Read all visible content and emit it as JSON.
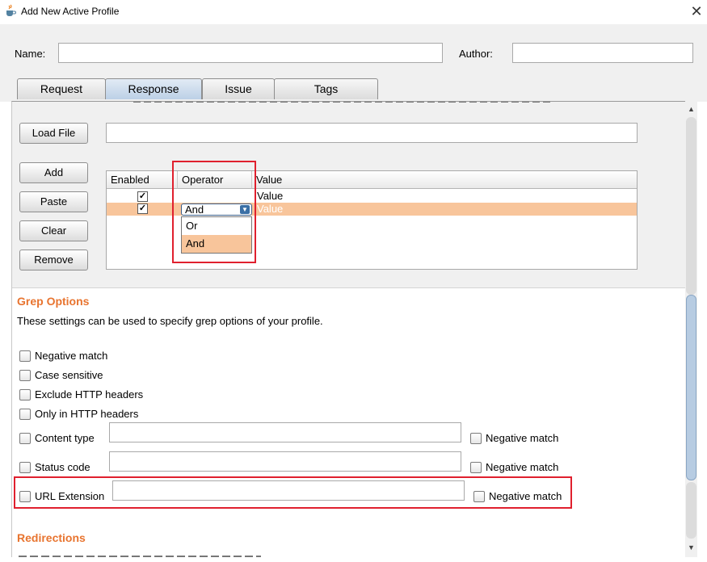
{
  "window": {
    "title": "Add New Active Profile",
    "close_glyph": "✕"
  },
  "header": {
    "name_label": "Name:",
    "name_value": "",
    "author_label": "Author:",
    "author_value": ""
  },
  "tabs": [
    {
      "label": "Request",
      "active": false
    },
    {
      "label": "Response",
      "active": true
    },
    {
      "label": "Issue",
      "active": false
    },
    {
      "label": "Tags",
      "active": false
    }
  ],
  "match_panel": {
    "load_file_label": "Load File",
    "load_file_value": "",
    "add_label": "Add",
    "paste_label": "Paste",
    "clear_label": "Clear",
    "remove_label": "Remove",
    "table": {
      "columns": [
        "Enabled",
        "Operator",
        "Value"
      ],
      "rows": [
        {
          "enabled": true,
          "operator": "",
          "value": "Value",
          "selected": false
        },
        {
          "enabled": true,
          "operator": "And",
          "value": "Value",
          "selected": true
        }
      ]
    },
    "operator_dropdown": {
      "selected": "And",
      "options": [
        "Or",
        "And"
      ],
      "highlighted": "And"
    }
  },
  "grep_options": {
    "title": "Grep Options",
    "description": "These settings can be used to specify grep options of your profile.",
    "checkboxes": [
      {
        "label": "Negative match",
        "checked": false
      },
      {
        "label": "Case sensitive",
        "checked": false
      },
      {
        "label": "Exclude HTTP headers",
        "checked": false
      },
      {
        "label": "Only in HTTP headers",
        "checked": false
      }
    ],
    "content_type": {
      "label": "Content type",
      "value": "",
      "negative_label": "Negative match"
    },
    "status_code": {
      "label": "Status code",
      "value": "",
      "negative_label": "Negative match"
    },
    "url_extension": {
      "label": "URL Extension",
      "value": "",
      "negative_label": "Negative match"
    }
  },
  "redirections": {
    "title": "Redirections"
  },
  "colors": {
    "accent": "#e8742f",
    "selection": "#f8c59b",
    "highlight_box": "#e0202e",
    "active_tab": "#bcd0e6"
  },
  "icons": {
    "app": "java-cup-icon",
    "close": "close-icon",
    "combo_arrow": "chevron-down-icon",
    "scroll_up": "arrow-up-icon",
    "scroll_down": "arrow-down-icon"
  }
}
